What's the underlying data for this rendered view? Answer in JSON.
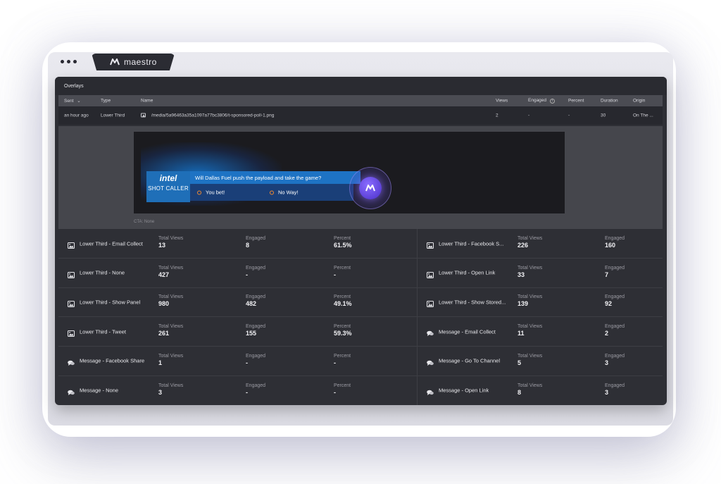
{
  "browser": {
    "brand": "maestro"
  },
  "section": {
    "title": "Overlays"
  },
  "table": {
    "headers": {
      "sent": "Sent",
      "type": "Type",
      "name": "Name",
      "views": "Views",
      "engaged": "Engaged",
      "percent": "Percent",
      "duration": "Duration",
      "origin": "Origin"
    },
    "row": {
      "sent": "an hour ago",
      "type": "Lower Third",
      "name": "/media/5a96463a35a1097a77bc3806/t-sponsored-poll-1.png",
      "views": "2",
      "engaged": "-",
      "percent": "-",
      "duration": "30",
      "origin": "On The ..."
    }
  },
  "preview": {
    "sponsor": "intel",
    "sponsor_sub": "SHOT CALLER",
    "question": "Will Dallas Fuel push the payload and take the game?",
    "option1": "You bet!",
    "option2": "No Way!",
    "cta": "CTA: None"
  },
  "stats": {
    "left": [
      {
        "icon": "image-icon",
        "name": "Lower Third - Email Collect",
        "views_label": "Total Views",
        "views": "13",
        "engaged_label": "Engaged",
        "engaged": "8",
        "percent_label": "Percent",
        "percent": "61.5%"
      },
      {
        "icon": "image-icon",
        "name": "Lower Third - None",
        "views_label": "Total Views",
        "views": "427",
        "engaged_label": "Engaged",
        "engaged": "-",
        "percent_label": "Percent",
        "percent": "-"
      },
      {
        "icon": "image-icon",
        "name": "Lower Third - Show Panel",
        "views_label": "Total Views",
        "views": "980",
        "engaged_label": "Engaged",
        "engaged": "482",
        "percent_label": "Percent",
        "percent": "49.1%"
      },
      {
        "icon": "image-icon",
        "name": "Lower Third - Tweet",
        "views_label": "Total Views",
        "views": "261",
        "engaged_label": "Engaged",
        "engaged": "155",
        "percent_label": "Percent",
        "percent": "59.3%"
      },
      {
        "icon": "chat-icon",
        "name": "Message - Facebook Share",
        "views_label": "Total Views",
        "views": "1",
        "engaged_label": "Engaged",
        "engaged": "-",
        "percent_label": "Percent",
        "percent": "-"
      },
      {
        "icon": "chat-icon",
        "name": "Message - None",
        "views_label": "Total Views",
        "views": "3",
        "engaged_label": "Engaged",
        "engaged": "-",
        "percent_label": "Percent",
        "percent": "-"
      }
    ],
    "right": [
      {
        "icon": "image-icon",
        "name": "Lower Third - Facebook S...",
        "views_label": "Total Views",
        "views": "226",
        "engaged_label": "Engaged",
        "engaged": "160"
      },
      {
        "icon": "image-icon",
        "name": "Lower Third - Open Link",
        "views_label": "Total Views",
        "views": "33",
        "engaged_label": "Engaged",
        "engaged": "7"
      },
      {
        "icon": "image-icon",
        "name": "Lower Third - Show Stored...",
        "views_label": "Total Views",
        "views": "139",
        "engaged_label": "Engaged",
        "engaged": "92"
      },
      {
        "icon": "chat-icon",
        "name": "Message - Email Collect",
        "views_label": "Total Views",
        "views": "11",
        "engaged_label": "Engaged",
        "engaged": "2"
      },
      {
        "icon": "chat-icon",
        "name": "Message - Go To Channel",
        "views_label": "Total Views",
        "views": "5",
        "engaged_label": "Engaged",
        "engaged": "3"
      },
      {
        "icon": "chat-icon",
        "name": "Message - Open Link",
        "views_label": "Total Views",
        "views": "8",
        "engaged_label": "Engaged",
        "engaged": "3"
      }
    ]
  },
  "colors": {
    "app_bg": "#2e2f35",
    "header_bg": "#4b4c53",
    "poll_blue": "#1e73c4",
    "option_ring": "#f28a2e",
    "badge_purple": "#6a4de8"
  }
}
